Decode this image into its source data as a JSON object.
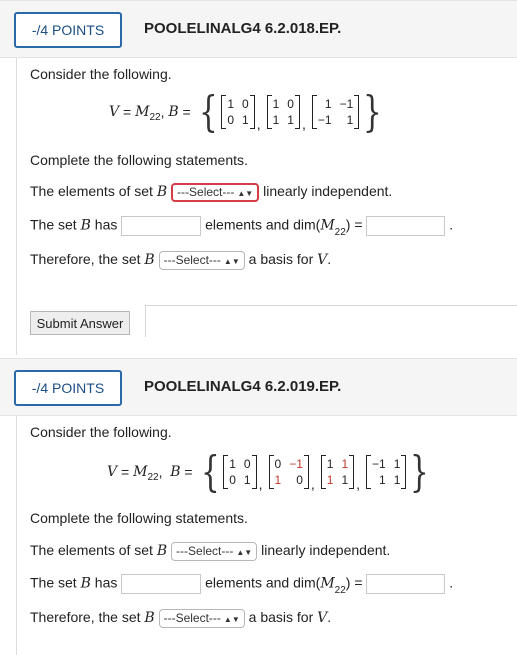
{
  "q1": {
    "points": "-/4 POINTS",
    "title": "POOLELINALG4 6.2.018.EP.",
    "intro": "Consider the following.",
    "V_label": "V",
    "space_M": "M",
    "space_sub": "22",
    "B_label": "B",
    "matrices": [
      [
        [
          "1",
          "0"
        ],
        [
          "0",
          "1"
        ]
      ],
      [
        [
          "1",
          "0"
        ],
        [
          "1",
          "1"
        ]
      ],
      [
        [
          "1",
          "−1"
        ],
        [
          "−1",
          "1"
        ]
      ]
    ],
    "complete": "Complete the following statements.",
    "s1_pre": "The elements of set",
    "s1_post": "linearly independent.",
    "s2_pre": "The set",
    "s2_has": "has",
    "s2_mid": "elements and dim(",
    "s2_close": ") =",
    "s2_end": ".",
    "s3_pre": "Therefore, the set",
    "s3_post": "a basis for",
    "s3_V": "V",
    "select_text": "---Select---",
    "submit": "Submit Answer"
  },
  "q2": {
    "points": "-/4 POINTS",
    "title": "POOLELINALG4 6.2.019.EP.",
    "intro": "Consider the following.",
    "V_label": "V",
    "space_M": "M",
    "space_sub": "22",
    "B_label": "B",
    "matrices": [
      [
        [
          "1",
          "0"
        ],
        [
          "0",
          "1"
        ]
      ],
      [
        [
          "0",
          "−1"
        ],
        [
          "1",
          "0"
        ]
      ],
      [
        [
          "1",
          "1"
        ],
        [
          "1",
          "1"
        ]
      ],
      [
        [
          "−1",
          "1"
        ],
        [
          "1",
          "1"
        ]
      ]
    ],
    "complete": "Complete the following statements.",
    "s1_pre": "The elements of set",
    "s1_post": "linearly independent.",
    "s2_pre": "The set",
    "s2_has": "has",
    "s2_mid": "elements and dim(",
    "s2_close": ") =",
    "s2_end": ".",
    "s3_pre": "Therefore, the set",
    "s3_post": "a basis for",
    "s3_V": "V",
    "select_text": "---Select---"
  },
  "colors": {
    "accent": "#2b6aa8",
    "highlight_border": "#d53d46",
    "header_bg": "#f5f5f5",
    "second_entries": "#c0392b"
  }
}
